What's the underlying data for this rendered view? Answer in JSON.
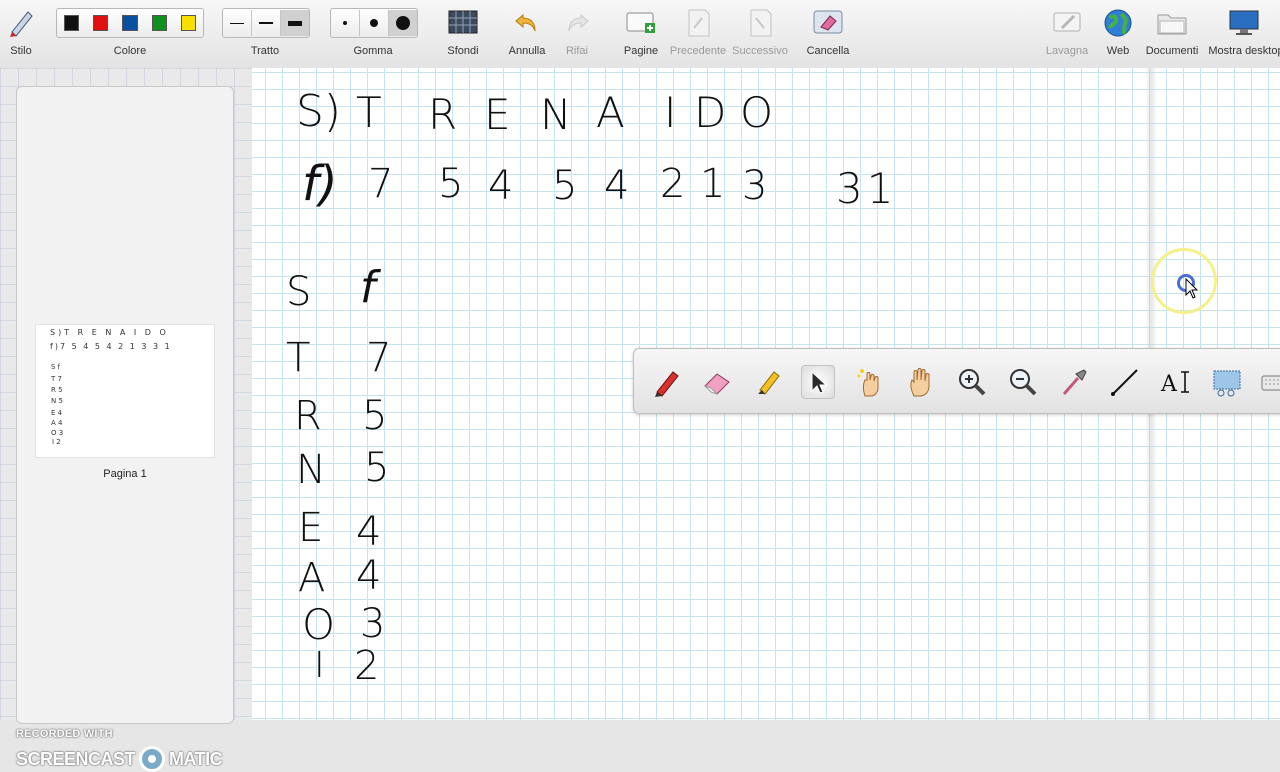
{
  "toolbar": {
    "stile": "Stilo",
    "colore": "Colore",
    "tratto": "Tratto",
    "gomma": "Gomma",
    "sfondi": "Sfondi",
    "annulla": "Annulla",
    "rifai": "Rifai",
    "pagine": "Pagine",
    "precedente": "Precedente",
    "successivo": "Successivo",
    "cancella": "Cancella",
    "lavagna": "Lavagna",
    "web": "Web",
    "documenti": "Documenti",
    "mostra_desktop": "Mostra desktop"
  },
  "colors": [
    "#111111",
    "#e01010",
    "#0a4fa0",
    "#10901c",
    "#f5e000"
  ],
  "side": {
    "page_label": "Pagina 1",
    "watermark_top": "RECORDED WITH",
    "watermark_left": "SCREENCAST",
    "watermark_right": "MATIC"
  },
  "board": {
    "row_s": [
      "S)",
      "T",
      "R",
      "E",
      "N",
      "A",
      "I",
      "D",
      "O"
    ],
    "row_f": [
      "f)",
      "7",
      "5",
      "4",
      "5",
      "4",
      "2",
      "1",
      "3",
      "31"
    ],
    "table": [
      [
        "S",
        "f"
      ],
      [
        "T",
        "7"
      ],
      [
        "R",
        "5"
      ],
      [
        "N",
        "5"
      ],
      [
        "E",
        "4"
      ],
      [
        "A",
        "4"
      ],
      [
        "O",
        "3"
      ],
      [
        "I",
        "2"
      ]
    ]
  },
  "float_tools": [
    "pen-icon",
    "eraser-icon",
    "highlighter-icon",
    "select-arrow-icon",
    "magic-hand-icon",
    "pan-hand-icon",
    "zoom-in-icon",
    "zoom-out-icon",
    "color-picker-icon",
    "line-icon",
    "text-icon",
    "screen-capture-icon",
    "keyboard-icon"
  ]
}
